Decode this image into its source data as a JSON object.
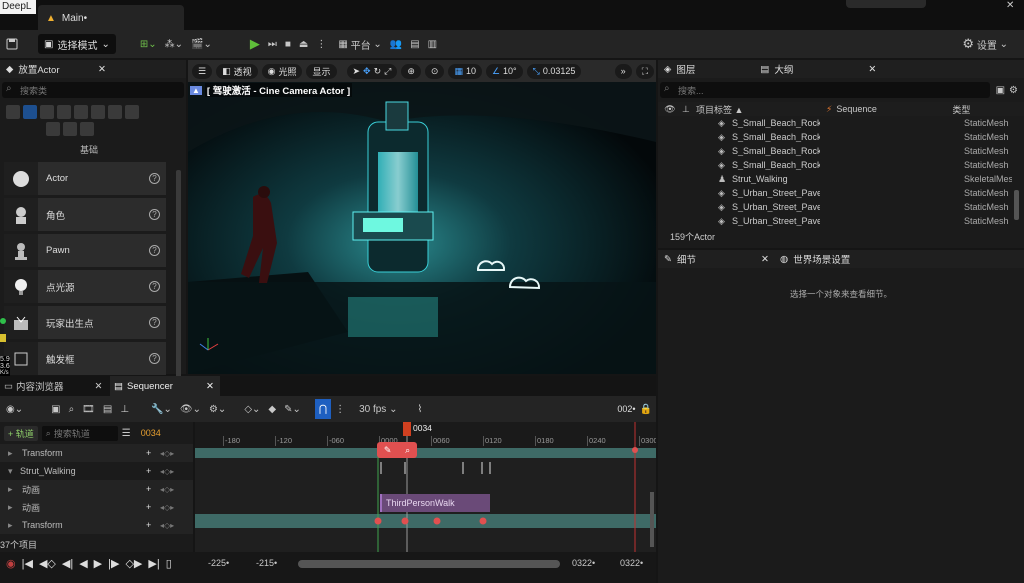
{
  "app": {
    "deepl": "DeepL",
    "tab_title": "Main•"
  },
  "toolbar": {
    "mode": "选择模式",
    "platform": "平台",
    "settings": "设置"
  },
  "place_actor": {
    "title": "放置Actor",
    "search_placeholder": "搜索类",
    "category": "基础",
    "items": [
      {
        "label": "Actor",
        "icon": "sphere-icon"
      },
      {
        "label": "角色",
        "icon": "character-icon"
      },
      {
        "label": "Pawn",
        "icon": "pawn-icon"
      },
      {
        "label": "点光源",
        "icon": "bulb-icon"
      },
      {
        "label": "玩家出生点",
        "icon": "player-start-icon"
      },
      {
        "label": "触发框",
        "icon": "trigger-box-icon"
      }
    ]
  },
  "viewport": {
    "perspective": "透视",
    "lit": "光照",
    "show": "显示",
    "grid_value": "10",
    "angle_value": "10°",
    "scale_value": "0.03125",
    "pilot_label": "[ 驾驶激活 - Cine Camera Actor ]"
  },
  "outliner": {
    "tab_layers": "图层",
    "tab_outliner": "大纲",
    "search_placeholder": "搜索...",
    "col_label": "项目标签 ▲",
    "col_sequence": "Sequence",
    "col_type": "类型",
    "rows": [
      {
        "name": "S_Small_Beach_Rock",
        "type": "StaticMesh"
      },
      {
        "name": "S_Small_Beach_Rock",
        "type": "StaticMesh"
      },
      {
        "name": "S_Small_Beach_Rock",
        "type": "StaticMesh"
      },
      {
        "name": "S_Small_Beach_Rock",
        "type": "StaticMesh"
      },
      {
        "name": "Strut_Walking",
        "type": "SkeletalMesh"
      },
      {
        "name": "S_Urban_Street_Pave",
        "type": "StaticMesh"
      },
      {
        "name": "S_Urban_Street_Pave",
        "type": "StaticMesh"
      },
      {
        "name": "S_Urban_Street_Pave",
        "type": "StaticMesh"
      }
    ],
    "count": "159个Actor"
  },
  "details": {
    "tab_details": "细节",
    "tab_world": "世界场景设置",
    "empty": "选择一个对象来查看细节。"
  },
  "bottom": {
    "tab_content": "内容浏览器",
    "tab_sequencer": "Sequencer"
  },
  "sequencer": {
    "fps": "30 fps",
    "frame_right": "002•",
    "add_track": "+ 轨道",
    "search_placeholder": "搜索轨道",
    "current_frame": "0034",
    "playhead_label": "0034",
    "ruler": [
      "-180",
      "-120",
      "-060",
      "0000",
      "0060",
      "0120",
      "0180",
      "0240",
      "0300"
    ],
    "tracks": [
      {
        "label": "Transform",
        "indent": 1
      },
      {
        "label": "Strut_Walking",
        "indent": 0
      },
      {
        "label": "动画",
        "indent": 1
      },
      {
        "label": "动画",
        "indent": 1
      },
      {
        "label": "Transform",
        "indent": 1
      }
    ],
    "clip_label": "ThirdPersonWalk",
    "items_count": "37个项目",
    "range_start": "-225•",
    "range_view_start": "-215•",
    "range_view_end": "0322•",
    "range_end": "0322•"
  },
  "side_numbers": [
    "5.9",
    "3.6",
    "K/s"
  ]
}
